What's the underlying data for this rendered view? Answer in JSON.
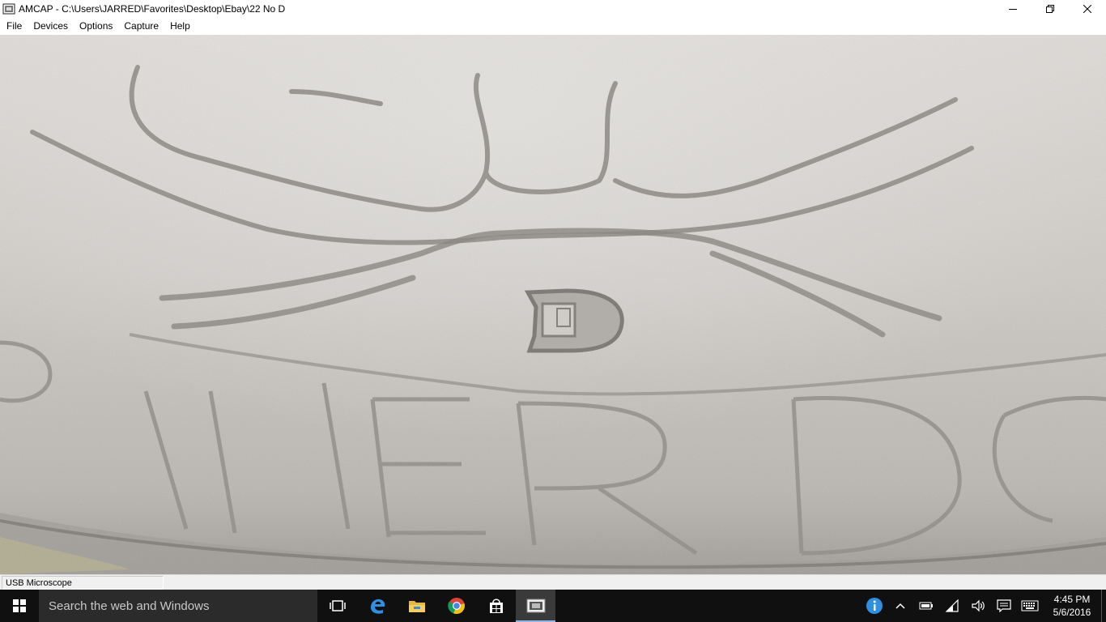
{
  "window": {
    "title": "AMCAP - C:\\Users\\JARRED\\Favorites\\Desktop\\Ebay\\22 No D"
  },
  "menu": {
    "items": [
      "File",
      "Devices",
      "Options",
      "Capture",
      "Help"
    ]
  },
  "preview": {
    "subject": "coin-closeup-image",
    "mint_mark": "D",
    "rim_lettering": [
      "E",
      "R",
      "D"
    ]
  },
  "statusbar": {
    "text": "USB Microscope"
  },
  "taskbar": {
    "search_placeholder": "Search the web and Windows",
    "pinned": [
      "task-view-icon",
      "edge-icon",
      "file-explorer-icon",
      "chrome-icon",
      "store-icon",
      "amcap-icon"
    ],
    "tray": [
      "info-icon",
      "chevron-up-icon",
      "battery-icon",
      "wifi-icon",
      "volume-icon",
      "action-center-icon",
      "keyboard-icon"
    ],
    "clock_time": "4:45 PM",
    "clock_date": "5/6/2016"
  },
  "colors": {
    "taskbar": "#101010",
    "search": "#2b2b2b",
    "accent": "#8fb5e6"
  }
}
